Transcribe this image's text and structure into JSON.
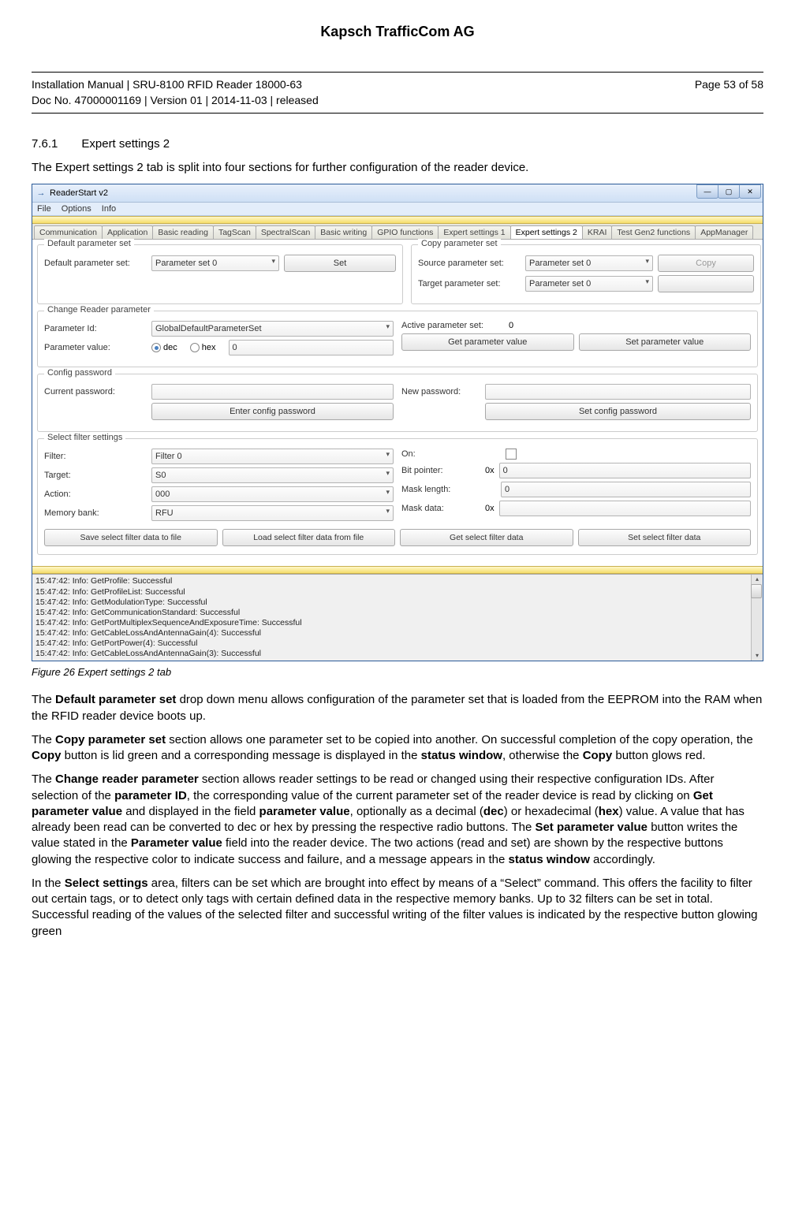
{
  "page": {
    "company": "Kapsch TrafficCom AG",
    "doc_line1": "Installation Manual | SRU-8100 RFID Reader 18000-63",
    "doc_line2": "Doc No. 47000001169 | Version 01 | 2014-11-03 | released",
    "page_num": "Page 53 of 58",
    "section_num": "7.6.1",
    "section_title": "Expert settings 2",
    "intro": "The Expert settings 2 tab is split into four sections for further configuration of the reader device.",
    "figure_caption": "Figure 26    Expert settings 2 tab"
  },
  "app": {
    "title": "ReaderStart v2",
    "menu": {
      "file": "File",
      "options": "Options",
      "info": "Info"
    },
    "tabs": [
      "Communication",
      "Application",
      "Basic reading",
      "TagScan",
      "SpectralScan",
      "Basic writing",
      "GPIO functions",
      "Expert settings 1",
      "Expert settings 2",
      "KRAI",
      "Test Gen2 functions",
      "AppManager"
    ],
    "active_tab": "Expert settings 2",
    "default_param": {
      "group": "Default parameter set",
      "label": "Default parameter set:",
      "value": "Parameter set 0",
      "set_btn": "Set"
    },
    "copy_param": {
      "group": "Copy parameter set",
      "source_label": "Source parameter set:",
      "source_value": "Parameter set 0",
      "target_label": "Target parameter set:",
      "target_value": "Parameter set 0",
      "copy_btn": "Copy",
      "blank_btn": ""
    },
    "change_param": {
      "group": "Change Reader parameter",
      "id_label": "Parameter Id:",
      "id_value": "GlobalDefaultParameterSet",
      "value_label": "Parameter value:",
      "dec": "dec",
      "hex": "hex",
      "value_field": "0",
      "active_label": "Active parameter set:",
      "active_value": "0",
      "get_btn": "Get parameter value",
      "set_btn": "Set parameter value"
    },
    "config_pw": {
      "group": "Config password",
      "current_label": "Current password:",
      "new_label": "New password:",
      "enter_btn": "Enter config password",
      "set_btn": "Set config password"
    },
    "filter": {
      "group": "Select filter settings",
      "filter_label": "Filter:",
      "filter_value": "Filter 0",
      "target_label": "Target:",
      "target_value": "S0",
      "action_label": "Action:",
      "action_value": "000",
      "membank_label": "Memory bank:",
      "membank_value": "RFU",
      "on_label": "On:",
      "bitptr_label": "Bit pointer:",
      "bitptr_prefix": "0x",
      "bitptr_value": "0",
      "masklen_label": "Mask length:",
      "masklen_value": "0",
      "maskdata_label": "Mask data:",
      "maskdata_prefix": "0x",
      "save_btn": "Save select filter data to file",
      "load_btn": "Load select filter data from file",
      "get_btn": "Get select filter data",
      "set_btn": "Set select filter data"
    },
    "log": [
      "15:47:42: Info: GetProfile: Successful",
      "15:47:42: Info: GetProfileList: Successful",
      "15:47:42: Info: GetModulationType: Successful",
      "15:47:42: Info: GetCommunicationStandard: Successful",
      "15:47:42: Info: GetPortMultiplexSequenceAndExposureTime: Successful",
      "15:47:42: Info: GetCableLossAndAntennaGain(4): Successful",
      "15:47:42: Info: GetPortPower(4): Successful",
      "15:47:42: Info: GetCableLossAndAntennaGain(3): Successful"
    ]
  },
  "prose": {
    "p1a": "The ",
    "p1b": "Default parameter set",
    "p1c": " drop down menu allows configuration of the parameter set that is loaded from the EEPROM into the RAM when the RFID reader device boots up.",
    "p2a": "The ",
    "p2b": "Copy parameter set",
    "p2c": " section allows one parameter set to be copied into another. On successful completion of the copy operation, the ",
    "p2d": "Copy",
    "p2e": " button is lid green and a corresponding message is displayed in the ",
    "p2f": "status window",
    "p2g": ", otherwise the ",
    "p2h": "Copy",
    "p2i": " button glows red.",
    "p3a": "The ",
    "p3b": "Change reader parameter",
    "p3c": " section allows reader settings to be read or changed using their respective configuration IDs. After selection of the ",
    "p3d": "parameter ID",
    "p3e": ", the corresponding value of the current parameter set of the reader device is read by clicking on ",
    "p3f": "Get parameter value",
    "p3g": " and displayed in the field ",
    "p3h": "parameter value",
    "p3i": ", optionally as a decimal (",
    "p3j": "dec",
    "p3k": ") or hexadecimal (",
    "p3l": "hex",
    "p3m": ") value. A value that has already been read can be converted to dec or hex by pressing the respective radio buttons. The ",
    "p3n": "Set parameter value",
    "p3o": " button writes the value stated in the ",
    "p3p": "Parameter value",
    "p3q": " field into the reader device. The two actions (read and set) are shown by the respective buttons glowing the respective color to indicate success and failure, and a message appears in the ",
    "p3r": "status window",
    "p3s": " accordingly.",
    "p4a": "In the ",
    "p4b": "Select settings",
    "p4c": " area, filters can be set which are brought into effect by means of a “Select” command. This offers the facility to filter out certain tags, or to detect only tags with certain defined data in the respective memory banks. Up to 32 filters can be set in total. Successful reading of the values of the selected filter and successful writing of the filter values is indicated by the respective button glowing green"
  }
}
